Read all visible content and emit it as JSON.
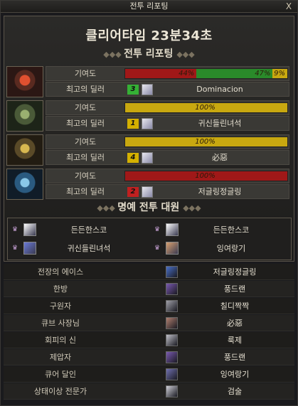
{
  "window": {
    "title": "전투 리포팅",
    "close_label": "X"
  },
  "clear_time": "클리어타임  23분34초",
  "sections": {
    "report_title": "전투 리포팅",
    "honor_title": "명예 전투 대원"
  },
  "bosses": [
    {
      "portrait": "red-boss-icon",
      "contrib_label": "기여도",
      "dealer_label": "최고의 딜러",
      "segments": [
        {
          "percent": 44,
          "text": "44%",
          "color": "#a01818"
        },
        {
          "percent": 47,
          "text": "47%",
          "color": "#2a8a2a"
        },
        {
          "percent": 9,
          "text": "9%",
          "color": "#c8a810"
        }
      ],
      "rank": "3",
      "rank_color": "#35b035",
      "dealer": "Dominacion"
    },
    {
      "portrait": "green-boss-icon",
      "contrib_label": "기여도",
      "dealer_label": "최고의 딜러",
      "segments": [
        {
          "percent": 100,
          "text": "100%",
          "color": "#c8a810"
        }
      ],
      "rank": "1",
      "rank_color": "#d4b000",
      "dealer": "귀신들린녀석"
    },
    {
      "portrait": "gold-boss-icon",
      "contrib_label": "기여도",
      "dealer_label": "최고의 딜러",
      "segments": [
        {
          "percent": 100,
          "text": "100%",
          "color": "#c8a810"
        }
      ],
      "rank": "4",
      "rank_color": "#d4b000",
      "dealer": "必惡"
    },
    {
      "portrait": "blue-boss-icon",
      "contrib_label": "기여도",
      "dealer_label": "최고의 딜러",
      "segments": [
        {
          "percent": 100,
          "text": "100%",
          "color": "#a01818"
        }
      ],
      "rank": "2",
      "rank_color": "#c02020",
      "dealer": "저글링정글링"
    }
  ],
  "honor": [
    {
      "name": "든든한스코",
      "avatar_color": "#ffffff"
    },
    {
      "name": "든든한스코",
      "avatar_color": "#ffffff"
    },
    {
      "name": "귀신들린녀석",
      "avatar_color": "#6a7ad8"
    },
    {
      "name": "잉여랑기",
      "avatar_color": "#d8a070"
    }
  ],
  "awards": [
    {
      "title": "전장의 에이스",
      "name": "저글링정글링",
      "avatar_color": "#4a70c8"
    },
    {
      "title": "한방",
      "name": "풍드랜",
      "avatar_color": "#7a5ab0"
    },
    {
      "title": "구원자",
      "name": "칠디짝짝",
      "avatar_color": "#a0a0a8"
    },
    {
      "title": "큐브 사장님",
      "name": "必惡",
      "avatar_color": "#b08070"
    },
    {
      "title": "회피의 신",
      "name": "룩제",
      "avatar_color": "#c0c0c8"
    },
    {
      "title": "제압자",
      "name": "풍드랜",
      "avatar_color": "#7a5ab0"
    },
    {
      "title": "큐어 달인",
      "name": "잉여랑기",
      "avatar_color": "#7070b0"
    },
    {
      "title": "상태이상 전문가",
      "name": "검술",
      "avatar_color": "#d0d0d8"
    }
  ]
}
